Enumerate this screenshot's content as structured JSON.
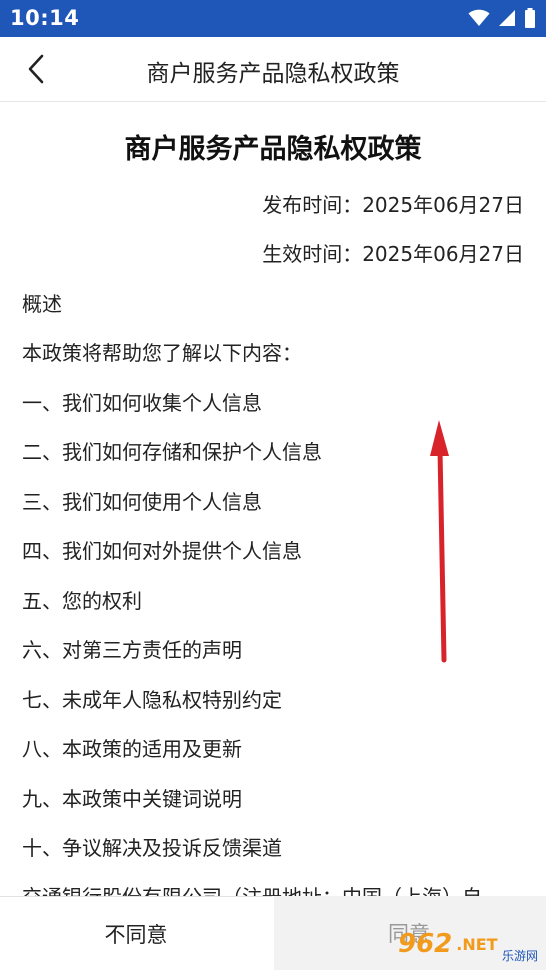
{
  "status": {
    "time": "10:14",
    "icons": [
      "wifi-icon",
      "signal-icon",
      "battery-icon"
    ]
  },
  "toolbar": {
    "back_icon": "chevron-left-icon",
    "title": "商户服务产品隐私权政策"
  },
  "document": {
    "title": "商户服务产品隐私权政策",
    "publish": "发布时间：2025年06月27日",
    "effective": "生效时间：2025年06月27日",
    "lines": [
      "概述",
      "本政策将帮助您了解以下内容：",
      "一、我们如何收集个人信息",
      "二、我们如何存储和保护个人信息",
      "三、我们如何使用个人信息",
      "四、我们如何对外提供个人信息",
      "五、您的权利",
      "六、对第三方责任的声明",
      "七、未成年人隐私权特别约定",
      "八、本政策的适用及更新",
      "九、本政策中关键词说明",
      "十、争议解决及投诉反馈渠道",
      "交通银行股份有限公司（注册地址：中国（上海）自"
    ]
  },
  "buttons": {
    "disagree": "不同意",
    "agree": "同意"
  },
  "watermark": {
    "num": "962",
    "suffix": ".NET",
    "cn": "乐游网"
  },
  "colors": {
    "status_bar": "#1f57b8",
    "annotation_arrow": "#d9232b"
  }
}
